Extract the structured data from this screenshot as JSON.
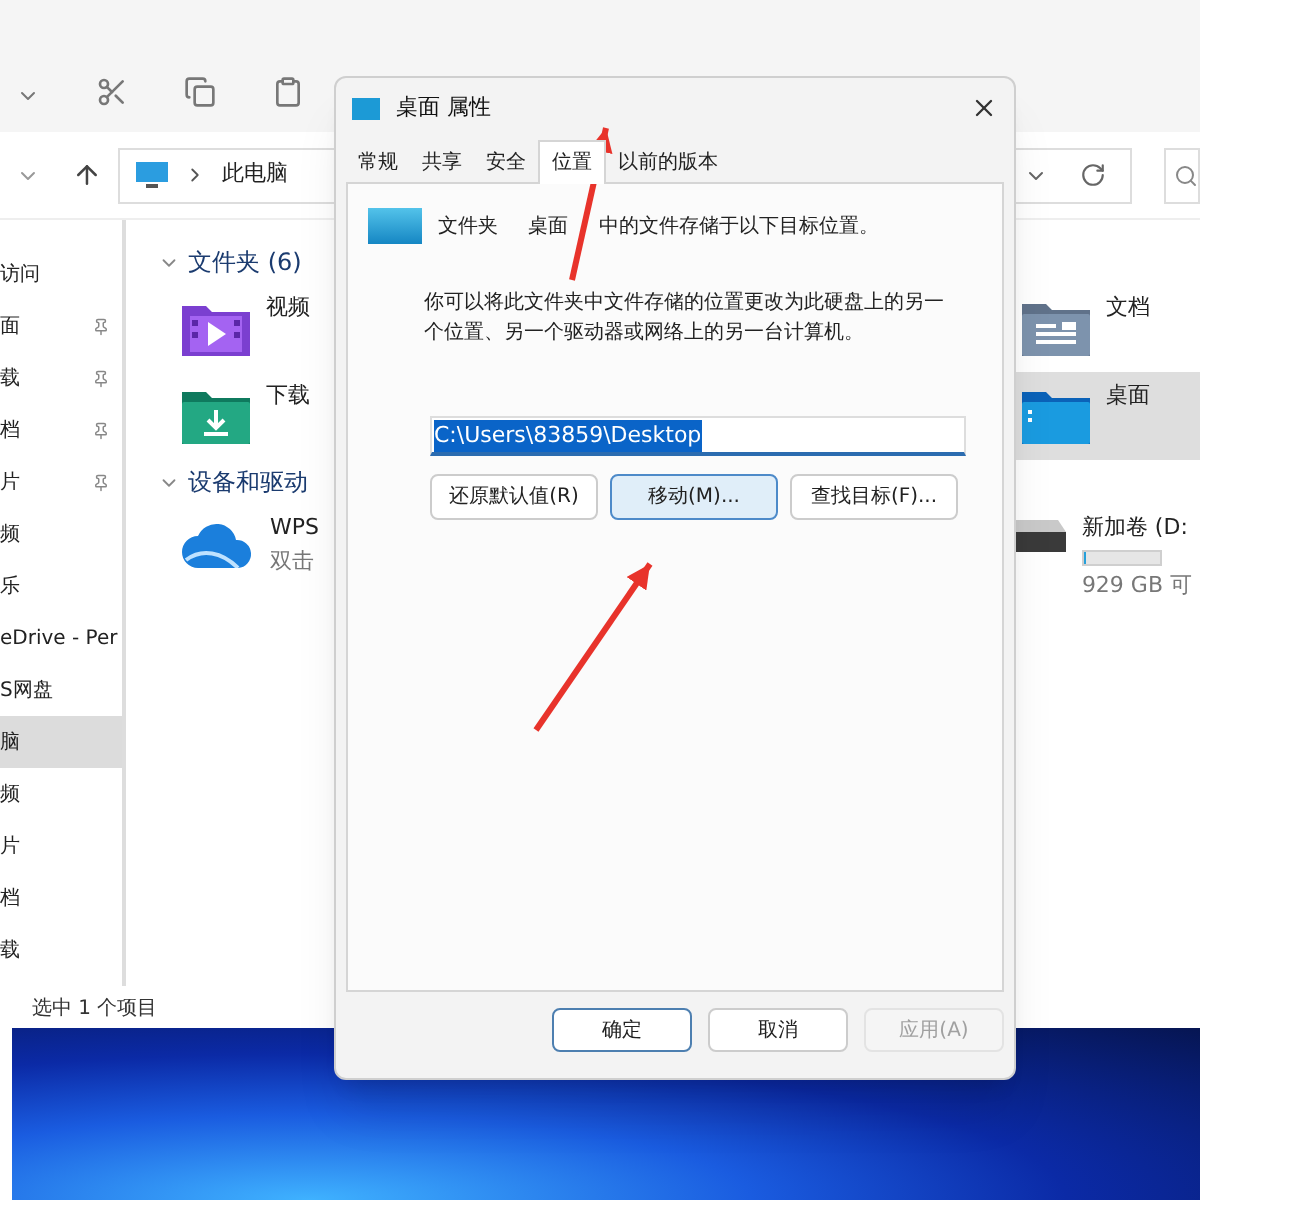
{
  "explorer": {
    "address": {
      "path": "此电脑"
    },
    "sidebar": {
      "items": [
        {
          "label": "访问",
          "pinned": false,
          "selected": false
        },
        {
          "label": "面",
          "pinned": true,
          "selected": false
        },
        {
          "label": "载",
          "pinned": true,
          "selected": false
        },
        {
          "label": "档",
          "pinned": true,
          "selected": false
        },
        {
          "label": "片",
          "pinned": true,
          "selected": false
        },
        {
          "label": "频",
          "pinned": false,
          "selected": false
        },
        {
          "label": "乐",
          "pinned": false,
          "selected": false
        },
        {
          "label": "eDrive - Per",
          "pinned": false,
          "selected": false
        },
        {
          "label": "S网盘",
          "pinned": false,
          "selected": false
        },
        {
          "label": "脑",
          "pinned": false,
          "selected": true
        },
        {
          "label": "频",
          "pinned": false,
          "selected": false
        },
        {
          "label": "片",
          "pinned": false,
          "selected": false
        },
        {
          "label": "档",
          "pinned": false,
          "selected": false
        },
        {
          "label": "载",
          "pinned": false,
          "selected": false
        }
      ]
    },
    "sections": [
      {
        "title": "文件夹 (6)",
        "left": [
          {
            "kind": "video",
            "name": "视频",
            "selected": false
          },
          {
            "kind": "download",
            "name": "下载",
            "selected": false
          }
        ],
        "right": [
          {
            "kind": "documents",
            "name": "文档",
            "selected": false
          },
          {
            "kind": "desktop",
            "name": "桌面",
            "selected": true
          }
        ]
      },
      {
        "title": "设备和驱动",
        "left": [
          {
            "kind": "cloud",
            "name": "WPS",
            "detail": "双击",
            "selected": false
          }
        ],
        "right": [
          {
            "kind": "drive",
            "name": "新加卷 (D:",
            "level": 0.04,
            "detail": "929 GB 可",
            "selected": false
          }
        ]
      }
    ],
    "status_bar": "选中 1 个项目"
  },
  "dialog": {
    "title": "桌面 属性",
    "tabs": [
      {
        "label": "常规",
        "selected": false
      },
      {
        "label": "共享",
        "selected": false
      },
      {
        "label": "安全",
        "selected": false
      },
      {
        "label": "位置",
        "selected": true
      },
      {
        "label": "以前的版本",
        "selected": false
      }
    ],
    "intro": "文件夹 桌面 中的文件存储于以下目标位置。",
    "description": "你可以将此文件夹中文件存储的位置更改为此硬盘上的另一个位置、另一个驱动器或网络上的另一台计算机。",
    "path": {
      "value": "C:\\Users\\83859\\Desktop",
      "highlighted": true
    },
    "actions": [
      {
        "label": "还原默认值(R)",
        "focused": false
      },
      {
        "label": "移动(M)...",
        "focused": true
      },
      {
        "label": "查找目标(F)...",
        "focused": false
      }
    ],
    "buttons": [
      {
        "label": "确定",
        "default": true,
        "disabled": false
      },
      {
        "label": "取消",
        "default": false,
        "disabled": false
      },
      {
        "label": "应用(A)",
        "default": false,
        "disabled": true
      }
    ]
  }
}
